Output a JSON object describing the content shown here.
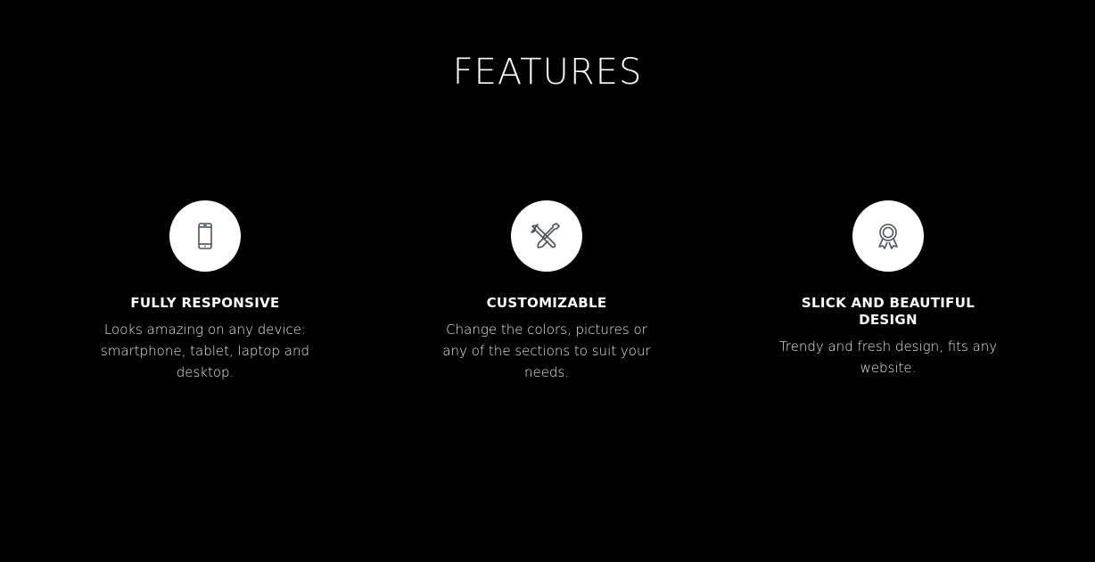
{
  "section": {
    "title": "FEATURES"
  },
  "features": [
    {
      "icon": "smartphone-icon",
      "title": "FULLY RESPONSIVE",
      "description": "Looks amazing on any device: smartphone, tablet, laptop and desktop."
    },
    {
      "icon": "tools-icon",
      "title": "CUSTOMIZABLE",
      "description": "Change the colors, pictures or any of the sections to suit your needs."
    },
    {
      "icon": "award-ribbon-icon",
      "title": "SLICK AND BEAUTIFUL DESIGN",
      "description": "Trendy and fresh design, fits any website."
    }
  ],
  "colors": {
    "background": "#000000",
    "text": "#ffffff",
    "icon_circle": "#ffffff",
    "icon_stroke": "#4a5560"
  }
}
